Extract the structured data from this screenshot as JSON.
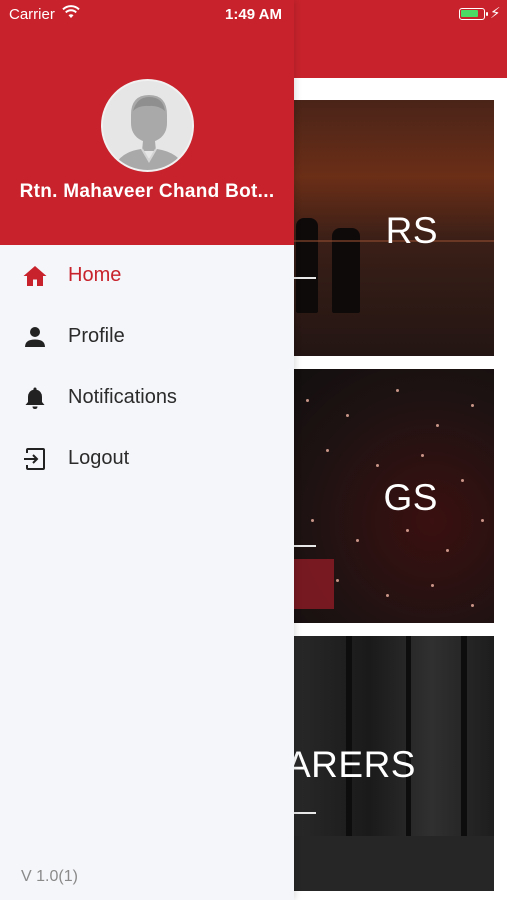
{
  "status_bar": {
    "carrier": "Carrier",
    "time": "1:49 AM",
    "wifi_icon": "wifi-icon",
    "battery_icon": "battery-charging-icon"
  },
  "drawer": {
    "user_name": "Rtn. Mahaveer Chand Bot...",
    "avatar_icon": "avatar-placeholder",
    "menu": [
      {
        "label": "Home",
        "icon": "home-icon",
        "active": true
      },
      {
        "label": "Profile",
        "icon": "person-icon",
        "active": false
      },
      {
        "label": "Notifications",
        "icon": "bell-icon",
        "active": false
      },
      {
        "label": "Logout",
        "icon": "logout-icon",
        "active": false
      }
    ],
    "version": "V 1.0(1)"
  },
  "background": {
    "cards": [
      {
        "title": "RS"
      },
      {
        "title": "GS"
      },
      {
        "title": "ARERS"
      }
    ]
  },
  "colors": {
    "brand_red": "#c8232c",
    "drawer_bg": "#f5f6fa",
    "text_dark": "#2b2b2b",
    "version_gray": "#8a8a8a"
  }
}
